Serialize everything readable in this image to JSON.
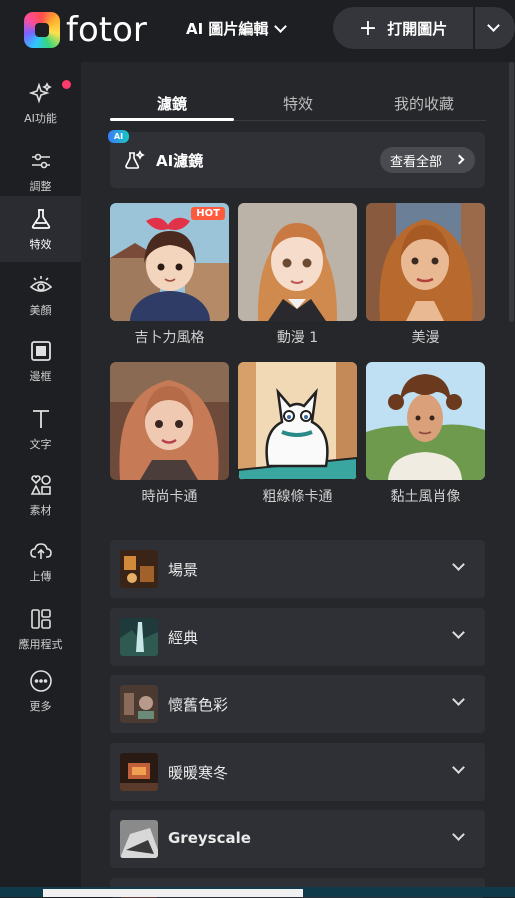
{
  "app": {
    "logo_text": "fotor",
    "mode_label": "AI 圖片編輯",
    "open_label": "打開圖片"
  },
  "sidebar": {
    "items": [
      {
        "label": "AI功能",
        "icon": "sparkle-icon"
      },
      {
        "label": "調整",
        "icon": "sliders-icon"
      },
      {
        "label": "特效",
        "icon": "flask-icon",
        "active": true
      },
      {
        "label": "美顏",
        "icon": "eye-icon"
      },
      {
        "label": "邊框",
        "icon": "frame-icon"
      },
      {
        "label": "文字",
        "icon": "text-icon"
      },
      {
        "label": "素材",
        "icon": "shapes-icon"
      },
      {
        "label": "上傳",
        "icon": "cloud-upload-icon"
      },
      {
        "label": "應用程式",
        "icon": "apps-icon"
      },
      {
        "label": "更多",
        "icon": "more-icon"
      }
    ]
  },
  "tabs": [
    {
      "label": "濾鏡",
      "active": true
    },
    {
      "label": "特效"
    },
    {
      "label": "我的收藏"
    }
  ],
  "ai_card": {
    "badge": "AI",
    "title": "AI濾鏡",
    "see_all": "查看全部"
  },
  "filters": [
    {
      "label": "吉卜力風格",
      "badge": "HOT"
    },
    {
      "label": "動漫 1"
    },
    {
      "label": "美漫"
    },
    {
      "label": "時尚卡通"
    },
    {
      "label": "粗線條卡通"
    },
    {
      "label": "黏土風肖像"
    }
  ],
  "categories": [
    {
      "label": "場景"
    },
    {
      "label": "經典"
    },
    {
      "label": "懷舊色彩"
    },
    {
      "label": "暖暖寒冬"
    },
    {
      "label": "Greyscale"
    }
  ],
  "colors": {
    "accent_hot": "#ff5a3c",
    "notification_dot": "#ff3b6b",
    "panel_bg": "#26272b"
  }
}
